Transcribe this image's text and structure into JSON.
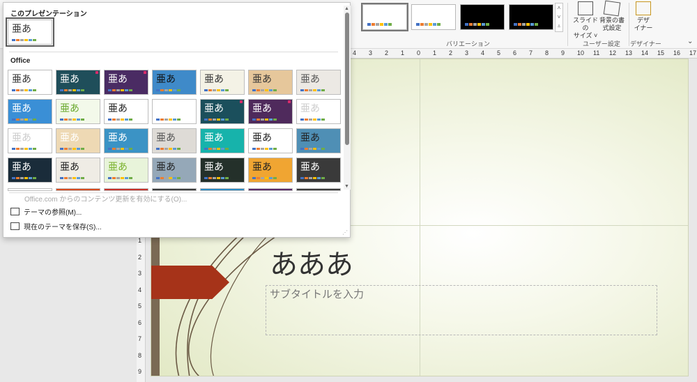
{
  "colors": {
    "accent": "#a63319",
    "slide_bg": "#f6f8ea",
    "dot_palette": [
      "#4472c4",
      "#ed7d31",
      "#a5a5a5",
      "#ffc000",
      "#5b9bd5",
      "#70ad47"
    ]
  },
  "ribbon": {
    "variants_label": "バリエーション",
    "user_settings_label": "ユーザー設定",
    "designer_label": "デザイナー",
    "slide_size_label": "スライドの\nサイズ ˅",
    "bg_format_label": "背景の書\n式設定",
    "designer_btn_label": "デザ\nイナー",
    "collapse_icon": "chevron-down-icon",
    "variants": [
      {
        "bg": "#ffffff",
        "selected": true
      },
      {
        "bg": "#ffffff",
        "selected": false
      },
      {
        "bg": "#000000",
        "selected": false
      },
      {
        "bg": "#000000",
        "selected": false
      }
    ]
  },
  "ruler": {
    "h_ticks": [
      "4",
      "3",
      "2",
      "1",
      "0",
      "1",
      "2",
      "3",
      "4",
      "5",
      "6",
      "7",
      "8",
      "9",
      "10",
      "11",
      "12",
      "13",
      "14",
      "15",
      "16",
      "17"
    ],
    "v_ticks": [
      "1",
      "2",
      "3",
      "4",
      "5",
      "6",
      "7",
      "8",
      "9"
    ]
  },
  "gallery": {
    "this_presentation_title": "このプレゼンテーション",
    "office_title": "Office",
    "glyph": "亜あ",
    "current_theme_glyph": "亜あ",
    "office_update_text": "Office.com からのコンテンツ更新を有効にする(O)...",
    "browse_label": "テーマの参照(M)...",
    "save_label": "現在のテーマを保存(S)...",
    "themes": [
      {
        "bg": "#ffffff",
        "fg": "#333333"
      },
      {
        "bg": "#1f4e5a",
        "fg": "#ffffff"
      },
      {
        "bg": "#4a2b63",
        "fg": "#ffffff"
      },
      {
        "bg": "#3f8ac9",
        "fg": "#111111"
      },
      {
        "bg": "#f4f2e6",
        "fg": "#333333"
      },
      {
        "bg": "#e6c79b",
        "fg": "#333333"
      },
      {
        "bg": "#ece9e4",
        "fg": "#555555"
      },
      {
        "bg": "#3a8fd6",
        "fg": "#ffffff"
      },
      {
        "bg": "#f3f9ea",
        "fg": "#69a82c"
      },
      {
        "bg": "#ffffff",
        "fg": "#222222"
      },
      {
        "bg": "#ffffff",
        "fg": "#ffffff"
      },
      {
        "bg": "#1b4f5c",
        "fg": "#ffffff"
      },
      {
        "bg": "#4f2a5c",
        "fg": "#ffffff"
      },
      {
        "bg": "#ffffff",
        "fg": "#cccccc"
      },
      {
        "bg": "#ffffff",
        "fg": "#cccccc"
      },
      {
        "bg": "#eed9b4",
        "fg": "#ffffff"
      },
      {
        "bg": "#3b93c5",
        "fg": "#ffffff"
      },
      {
        "bg": "#dedbd6",
        "fg": "#555555"
      },
      {
        "bg": "#17b3ab",
        "fg": "#ffffff"
      },
      {
        "bg": "#ffffff",
        "fg": "#222222"
      },
      {
        "bg": "#4f8fb5",
        "fg": "#222222"
      },
      {
        "bg": "#1a2c3a",
        "fg": "#ffffff"
      },
      {
        "bg": "#efece5",
        "fg": "#222222"
      },
      {
        "bg": "#e8f4da",
        "fg": "#7ab22d"
      },
      {
        "bg": "#95a8b8",
        "fg": "#222222"
      },
      {
        "bg": "#24302a",
        "fg": "#ffffff"
      },
      {
        "bg": "#f0a532",
        "fg": "#222222"
      },
      {
        "bg": "#3a3a3a",
        "fg": "#ffffff"
      }
    ]
  },
  "slide": {
    "title": "あああ",
    "subtitle_placeholder": "サブタイトルを入力"
  }
}
